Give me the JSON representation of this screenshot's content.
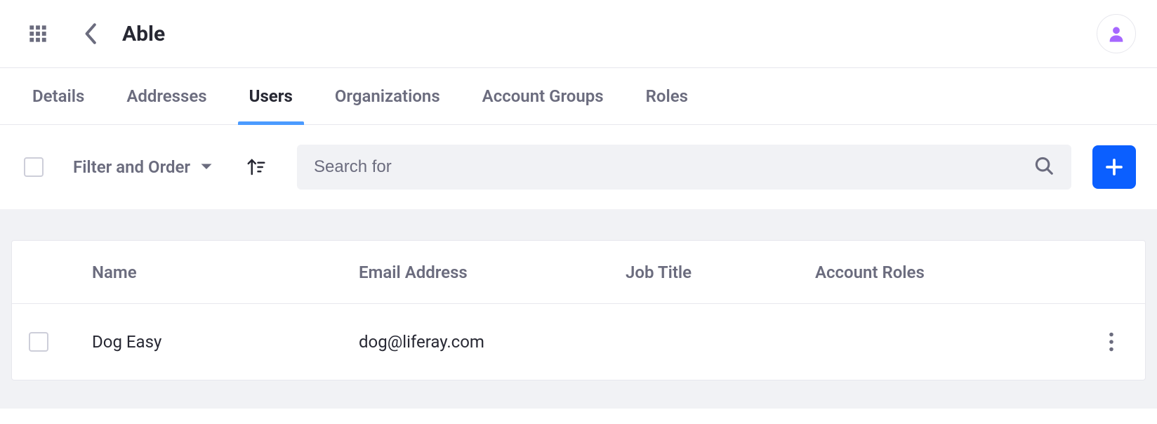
{
  "header": {
    "title": "Able"
  },
  "tabs": [
    {
      "label": "Details",
      "active": false
    },
    {
      "label": "Addresses",
      "active": false
    },
    {
      "label": "Users",
      "active": true
    },
    {
      "label": "Organizations",
      "active": false
    },
    {
      "label": "Account Groups",
      "active": false
    },
    {
      "label": "Roles",
      "active": false
    }
  ],
  "toolbar": {
    "filter_label": "Filter and Order",
    "search_placeholder": "Search for"
  },
  "table": {
    "columns": {
      "name": "Name",
      "email": "Email Address",
      "job_title": "Job Title",
      "account_roles": "Account Roles"
    },
    "rows": [
      {
        "name": "Dog Easy",
        "email": "dog@liferay.com",
        "job_title": "",
        "account_roles": ""
      }
    ]
  }
}
